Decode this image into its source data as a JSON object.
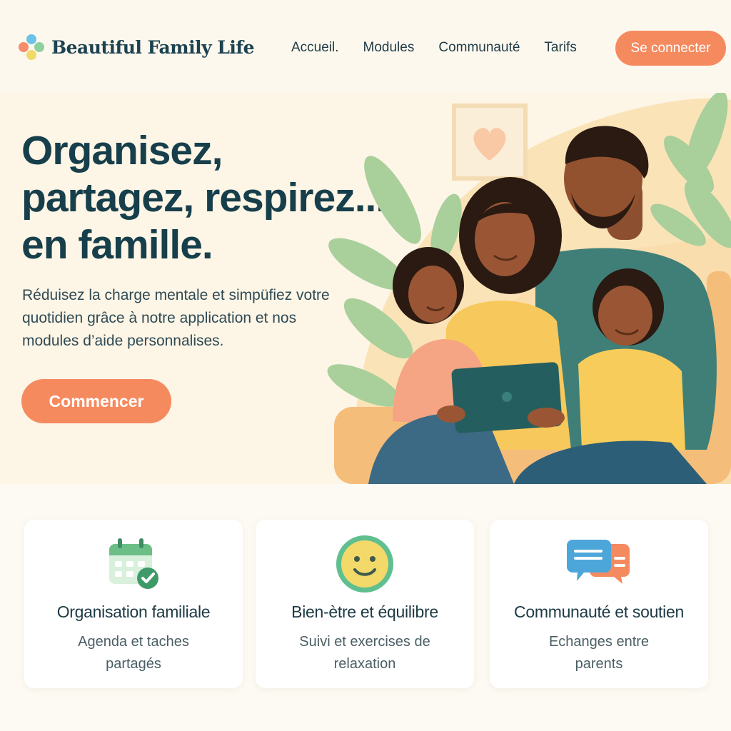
{
  "brand": {
    "name": "Beautiful Family Life",
    "logo_icon": "four-dots-logo-icon",
    "colors": [
      "#f58c6a",
      "#6cc3e8",
      "#8fd19e",
      "#f3d86a"
    ]
  },
  "nav": {
    "items": [
      "Accueil.",
      "Modules",
      "Communauté",
      "Tarifs"
    ],
    "login_label": "Se connecter"
  },
  "hero": {
    "title_lines": [
      "Organisez,",
      "partagez, respirez...",
      "en famille."
    ],
    "subtitle": "Réduisez la charge mentale et simpüfiez votre quotidien grâce à notre application et nos modules d’aide personnalises.",
    "cta_label": "Commencer",
    "illustration": "family-on-couch-with-tablet-illustration"
  },
  "features": [
    {
      "icon": "calendar-check-icon",
      "title": "Organisation familiale",
      "desc": "Agenda et taches partagés"
    },
    {
      "icon": "smiley-face-icon",
      "title": "Bien-ètre et équilibre",
      "desc": "Suivi et exercises de relaxation"
    },
    {
      "icon": "chat-bubbles-icon",
      "title": "Communauté et soutien",
      "desc": "Echanges entre parents"
    }
  ],
  "theme": {
    "accent": "#f68a5f",
    "heading": "#173f4b",
    "background": "#fdf8ee"
  }
}
